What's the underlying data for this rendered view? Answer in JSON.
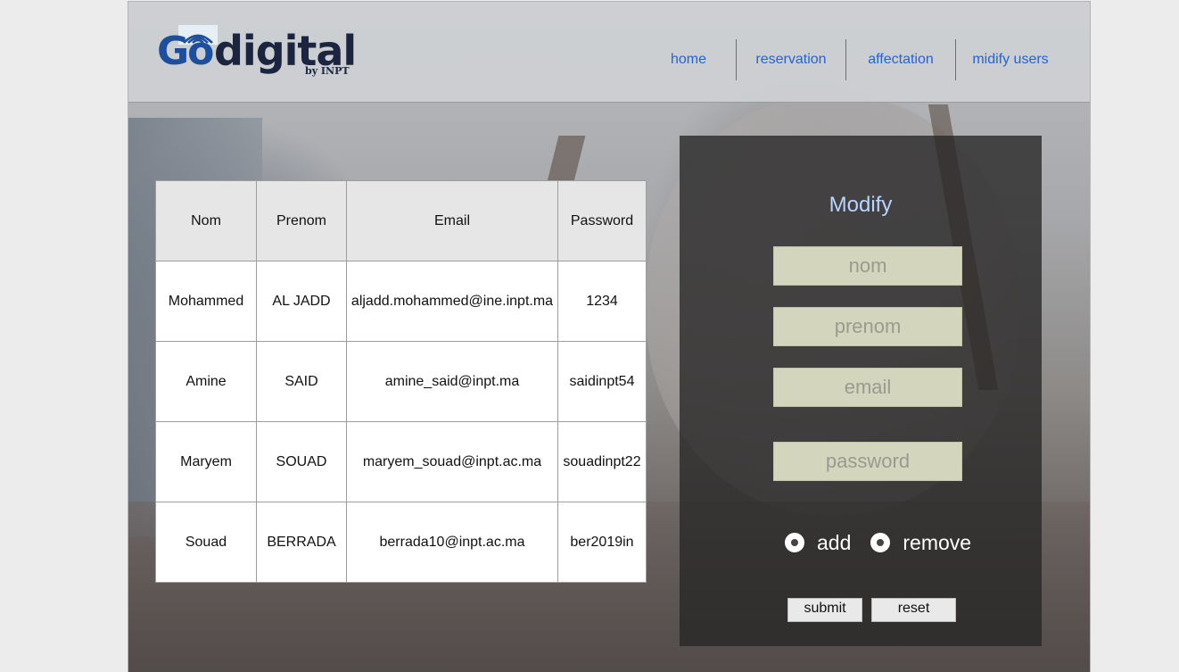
{
  "header": {
    "logo": {
      "go": "Go",
      "digital": "digital",
      "by": "by INPT"
    },
    "nav": [
      {
        "label": "home"
      },
      {
        "label": "reservation"
      },
      {
        "label": "affectation"
      },
      {
        "label": "midify users"
      }
    ]
  },
  "table": {
    "columns": [
      "Nom",
      "Prenom",
      "Email",
      "Password"
    ],
    "rows": [
      [
        "Mohammed",
        "AL JADD",
        "aljadd.mohammed@ine.inpt.ma",
        "1234"
      ],
      [
        "Amine",
        "SAID",
        "amine_said@inpt.ma",
        "saidinpt54"
      ],
      [
        "Maryem",
        "SOUAD",
        "maryem_souad@inpt.ac.ma",
        "souadinpt22"
      ],
      [
        "Souad",
        "BERRADA",
        "berrada10@inpt.ac.ma",
        "ber2019in"
      ]
    ]
  },
  "form": {
    "title": "Modify",
    "fields": {
      "nom": {
        "placeholder": "nom",
        "value": ""
      },
      "prenom": {
        "placeholder": "prenom",
        "value": ""
      },
      "email": {
        "placeholder": "email",
        "value": ""
      },
      "password": {
        "placeholder": "password",
        "value": ""
      }
    },
    "radios": {
      "add": "add",
      "remove": "remove"
    },
    "buttons": {
      "submit": "submit",
      "reset": "reset"
    }
  },
  "colors": {
    "nav_link": "#2463d6",
    "form_title": "#b8d4ff",
    "field_bg": "#d3d5bc",
    "logo_blue": "#1d4f9e",
    "logo_dark": "#1b2540"
  }
}
